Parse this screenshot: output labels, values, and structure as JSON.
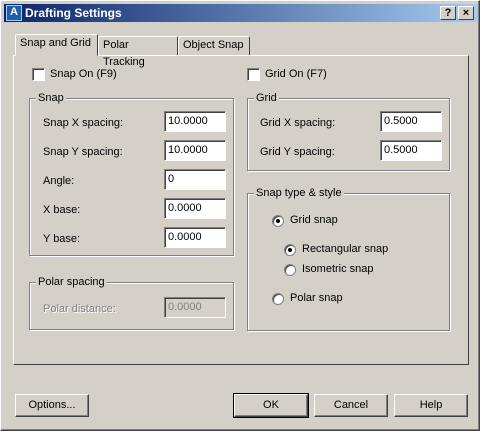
{
  "window": {
    "title": "Drafting Settings",
    "help_glyph": "?",
    "close_glyph": "×",
    "app_icon_glyph": "A",
    "colors": {
      "title_start": "#0a246a",
      "title_end": "#a6caf0",
      "face": "#d4d0c8"
    }
  },
  "tabs": [
    {
      "label": "Snap and Grid",
      "active": true
    },
    {
      "label": "Polar Tracking",
      "active": false
    },
    {
      "label": "Object Snap",
      "active": false
    }
  ],
  "snap_on": {
    "label": "Snap On (F9)",
    "checked": false
  },
  "grid_on": {
    "label": "Grid On (F7)",
    "checked": false
  },
  "snap_group": {
    "title": "Snap",
    "fields": [
      {
        "label": "Snap X spacing:",
        "value": "10.0000"
      },
      {
        "label": "Snap Y spacing:",
        "value": "10.0000"
      },
      {
        "label": "Angle:",
        "value": "0"
      },
      {
        "label": "X base:",
        "value": "0.0000"
      },
      {
        "label": "Y base:",
        "value": "0.0000"
      }
    ]
  },
  "polar_group": {
    "title": "Polar spacing",
    "distance_label": "Polar distance:",
    "distance_value": "0.0000",
    "enabled": false
  },
  "grid_group": {
    "title": "Grid",
    "fields": [
      {
        "label": "Grid X spacing:",
        "value": "0.5000"
      },
      {
        "label": "Grid Y spacing:",
        "value": "0.5000"
      }
    ]
  },
  "snap_type_group": {
    "title": "Snap type & style",
    "grid_snap": {
      "label": "Grid snap",
      "selected": true
    },
    "rectangular_snap": {
      "label": "Rectangular snap",
      "selected": true
    },
    "isometric_snap": {
      "label": "Isometric snap",
      "selected": false
    },
    "polar_snap": {
      "label": "Polar snap",
      "selected": false
    }
  },
  "buttons": {
    "options": "Options...",
    "ok": "OK",
    "cancel": "Cancel",
    "help": "Help"
  }
}
